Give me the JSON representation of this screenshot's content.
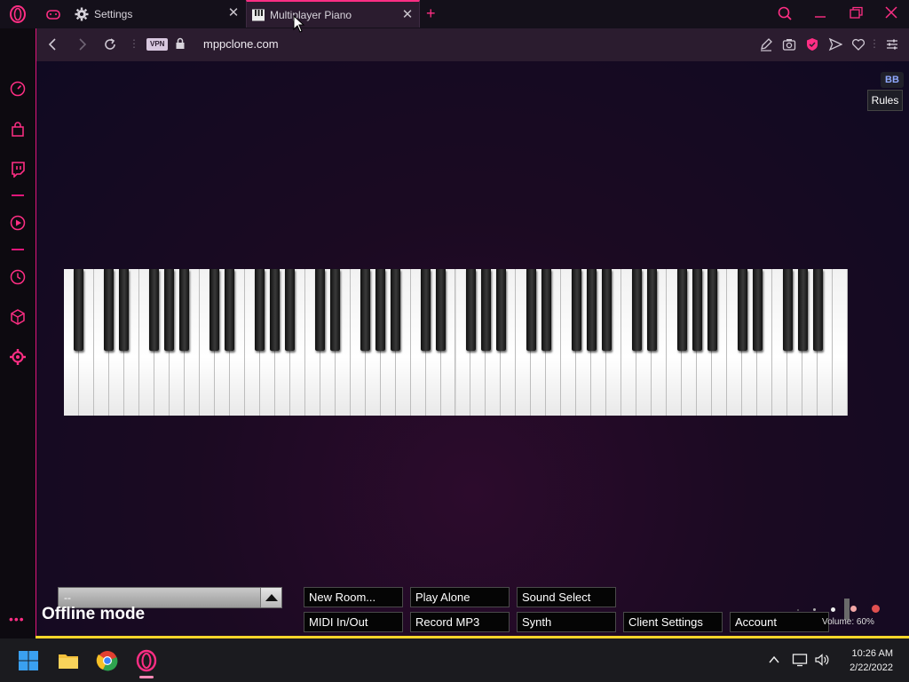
{
  "browser": {
    "tabs": [
      {
        "label": "Settings",
        "icon": "gear-icon"
      },
      {
        "label": "Multiplayer Piano",
        "icon": "piano-icon",
        "active": true
      }
    ],
    "address": {
      "url": "mppclone.com",
      "vpn_label": "VPN"
    },
    "accent_color": "#ff2e84"
  },
  "page": {
    "bb_badge": "BB",
    "rules_label": "Rules",
    "room_select_value": "--",
    "offline_label": "Offline mode",
    "buttons": {
      "new_room": "New Room...",
      "play_alone": "Play Alone",
      "sound_select": "Sound Select",
      "midi": "MIDI In/Out",
      "record_mp3": "Record MP3",
      "synth": "Synth",
      "client_settings": "Client Settings",
      "account": "Account"
    },
    "volume_label": "Volume: 60%",
    "volume": 0.6,
    "piano": {
      "white_keys": 52
    }
  },
  "taskbar": {
    "time": "10:26 AM",
    "date": "2/22/2022"
  }
}
